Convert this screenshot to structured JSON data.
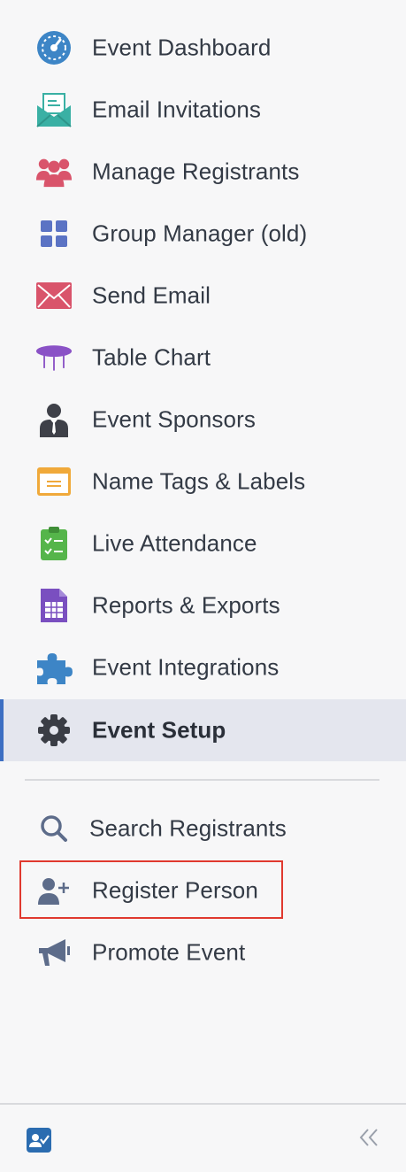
{
  "nav": {
    "items": [
      {
        "label": "Event Dashboard",
        "icon": "dashboard-gauge-icon",
        "color": "#3d85c6"
      },
      {
        "label": "Email Invitations",
        "icon": "envelope-open-icon",
        "color": "#3ab0a4"
      },
      {
        "label": "Manage Registrants",
        "icon": "people-group-icon",
        "color": "#d9546b"
      },
      {
        "label": "Group Manager (old)",
        "icon": "grid-icon",
        "color": "#5b73c4"
      },
      {
        "label": "Send Email",
        "icon": "envelope-icon",
        "color": "#d9546b"
      },
      {
        "label": "Table Chart",
        "icon": "table-icon",
        "color": "#8a52c6"
      },
      {
        "label": "Event Sponsors",
        "icon": "businessman-icon",
        "color": "#3e4048"
      },
      {
        "label": "Name Tags & Labels",
        "icon": "name-tag-icon",
        "color": "#f0a93a"
      },
      {
        "label": "Live Attendance",
        "icon": "clipboard-check-icon",
        "color": "#55b54a"
      },
      {
        "label": "Reports & Exports",
        "icon": "spreadsheet-icon",
        "color": "#7a4fc0"
      },
      {
        "label": "Event Integrations",
        "icon": "puzzle-piece-icon",
        "color": "#3d85c6"
      },
      {
        "label": "Event Setup",
        "icon": "gear-icon",
        "color": "#3a3d45",
        "active": true
      }
    ],
    "secondary": [
      {
        "label": "Search Registrants",
        "icon": "search-icon",
        "color": "#5d6c8a"
      },
      {
        "label": "Register Person",
        "icon": "add-user-icon",
        "color": "#5d6c8a",
        "highlighted": true
      },
      {
        "label": "Promote Event",
        "icon": "megaphone-icon",
        "color": "#5d6c8a"
      }
    ]
  },
  "footer": {
    "app_icon": "registration-check-icon",
    "collapse_icon": "double-chevron-left-icon",
    "accent": "#2b6cb0"
  }
}
